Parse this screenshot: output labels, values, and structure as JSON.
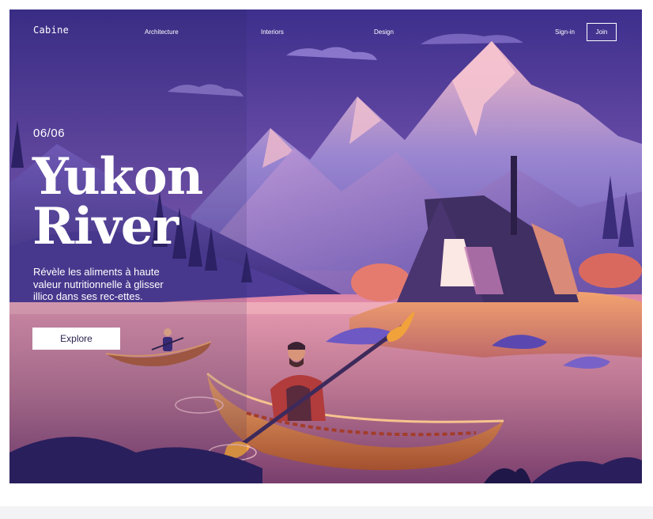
{
  "nav": {
    "brand": "Cabine",
    "links": [
      "Architecture",
      "Interiors",
      "Design"
    ],
    "signin": "Sign-in",
    "join": "Join"
  },
  "hero": {
    "counter": "06/06",
    "title_line1": "Yukon",
    "title_line2": "River",
    "description": "Révèle les aliments à haute valeur nutritionnelle à glisser illico dans ses rec-ettes.",
    "cta": "Explore"
  },
  "colors": {
    "sky_top": "#4b3a9b",
    "sky_glow": "#e48aa8",
    "mountain": "#8d84cf",
    "water": "#c27893",
    "accent_orange": "#f2a23a"
  },
  "icons": [
    "mountain-illustration",
    "cabin-illustration",
    "canoe-illustration"
  ]
}
